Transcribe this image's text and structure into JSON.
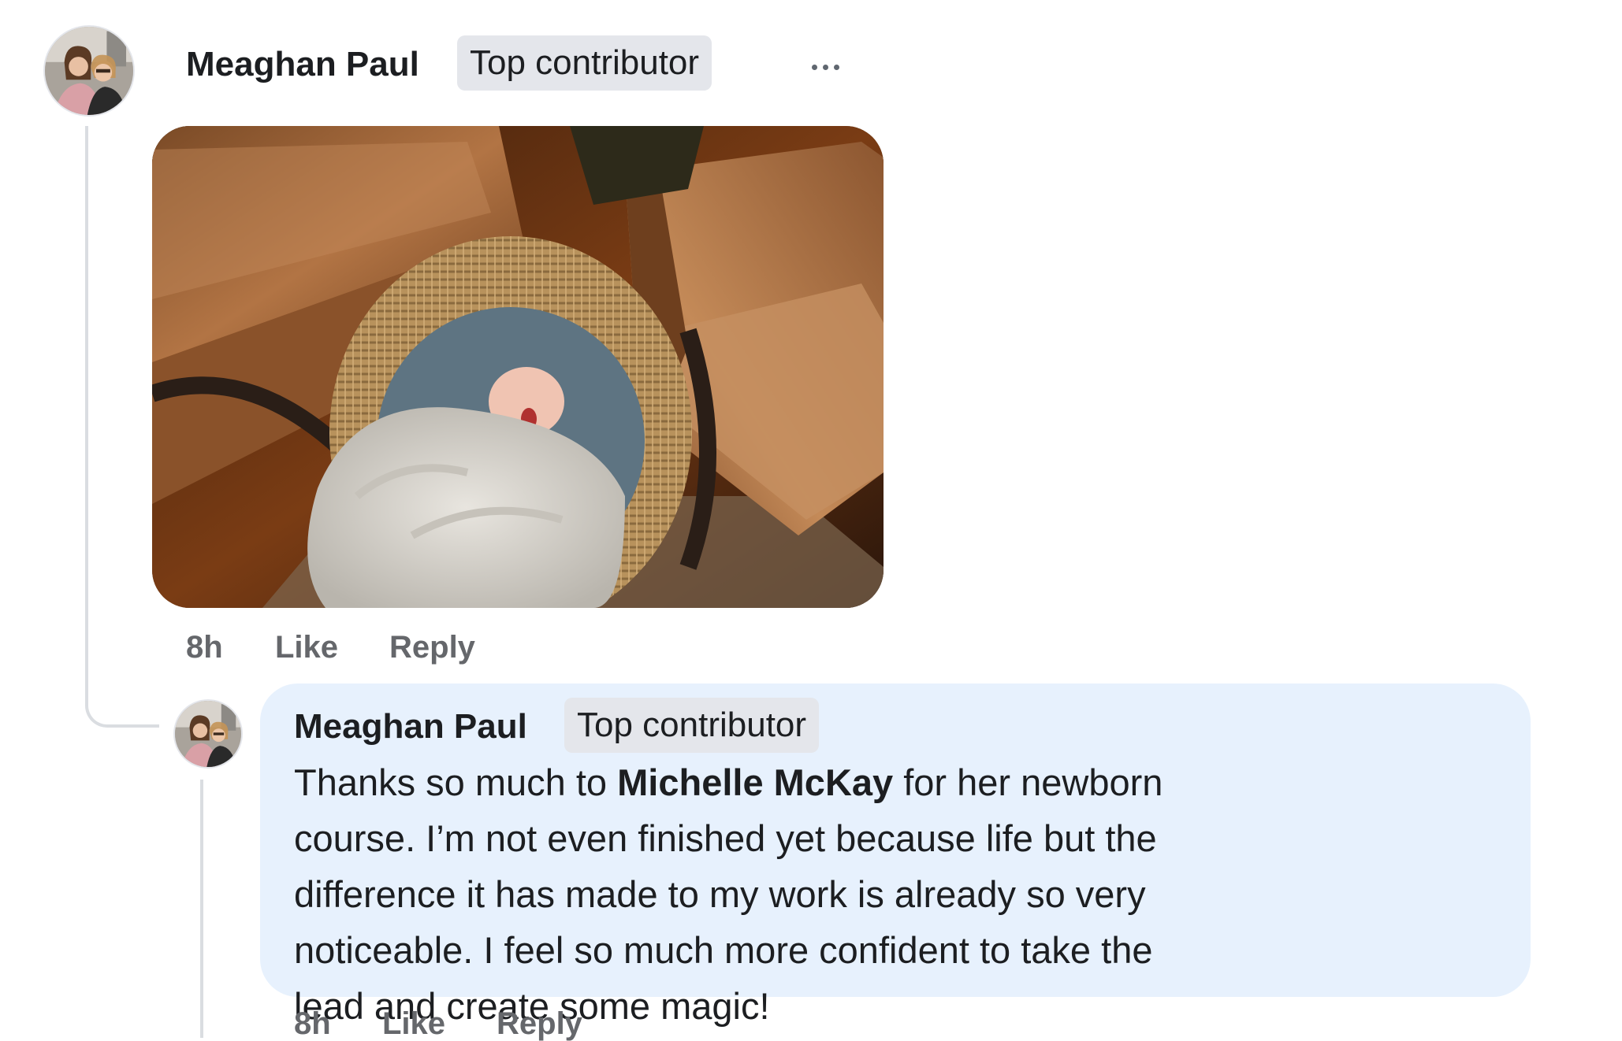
{
  "comment": {
    "author": "Meaghan Paul",
    "badge": "Top contributor",
    "more_icon": "more-horizontal-icon",
    "photo_alt": "Newborn baby yawning in a woven Moses basket between two leather chairs",
    "meta": {
      "time": "8h",
      "like_label": "Like",
      "reply_label": "Reply"
    }
  },
  "reply": {
    "author": "Meaghan Paul",
    "badge": "Top contributor",
    "text_before": "Thanks so much to ",
    "mention": "Michelle McKay",
    "text_after": " for her newborn course. I’m not even finished yet because life but the difference it has made to my work is already so very noticeable. I feel so much more confident to take the lead and create some magic!",
    "meta": {
      "time": "8h",
      "like_label": "Like",
      "reply_label": "Reply"
    }
  },
  "colors": {
    "reply_bubble": "#e7f1fd",
    "badge_bg": "#e4e6eb",
    "meta_text": "#65676b"
  }
}
